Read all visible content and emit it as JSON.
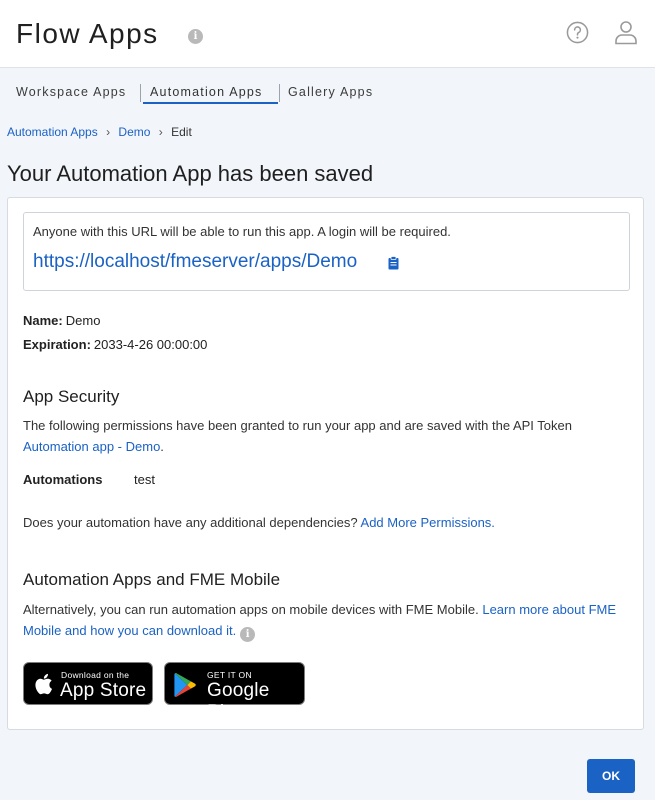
{
  "header": {
    "title": "Flow Apps",
    "info_icon": "info-icon",
    "help_icon": "question-circle-icon",
    "user_icon": "user-icon"
  },
  "tabs": [
    {
      "label": "Workspace Apps",
      "active": false
    },
    {
      "label": "Automation Apps",
      "active": true
    },
    {
      "label": "Gallery Apps",
      "active": false
    }
  ],
  "breadcrumb": {
    "items": [
      "Automation Apps",
      "Demo",
      "Edit"
    ]
  },
  "page_title": "Your Automation App has been saved",
  "url_box": {
    "notice": "Anyone with this URL will be able to run this app. A login will be required.",
    "url": "https://localhost/fmeserver/apps/Demo",
    "copy_icon": "clipboard-icon"
  },
  "details": {
    "name_label": "Name:",
    "name_value": "Demo",
    "expiration_label": "Expiration:",
    "expiration_value": "2033-4-26 00:00:00"
  },
  "security": {
    "title": "App Security",
    "description": "The following permissions have been granted to run your app and are saved with the API Token",
    "token_link": "Automation app - Demo",
    "token_suffix": ".",
    "permission_label": "Automations",
    "permission_value": "test",
    "dependencies_text": "Does your automation have any additional dependencies?",
    "add_permissions_link": "Add More Permissions."
  },
  "mobile": {
    "title": "Automation Apps and FME Mobile",
    "description": "Alternatively, you can run automation apps on mobile devices with FME Mobile.",
    "learn_more_link": "Learn more about FME Mobile and how you can download it.",
    "app_store": {
      "small": "Download on the",
      "big": "App Store"
    },
    "google_play": {
      "small": "GET IT ON",
      "big": "Google Play"
    }
  },
  "footer": {
    "ok_label": "OK"
  },
  "colors": {
    "accent": "#1b62c5",
    "background": "#f2f5f9"
  }
}
